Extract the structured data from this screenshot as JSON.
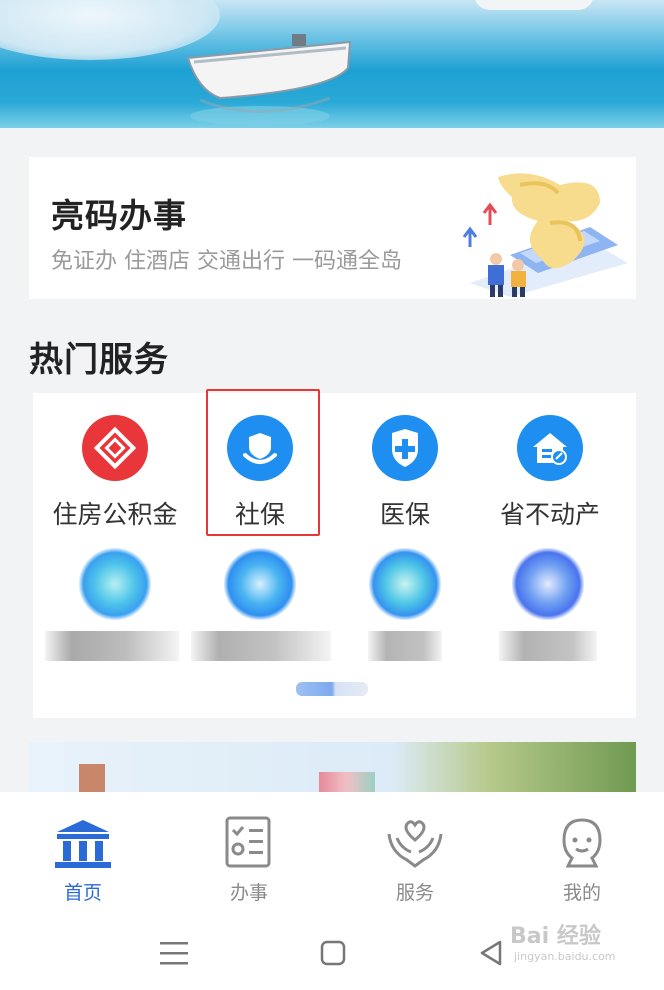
{
  "qr_card": {
    "title": "亮码办事",
    "subtitle": "免证办 住酒店 交通出行 一码通全岛"
  },
  "hot_services": {
    "title": "热门服务",
    "items": [
      {
        "label": "住房公积金",
        "icon": "housing-fund-icon",
        "color": "#e8363b"
      },
      {
        "label": "社保",
        "icon": "social-security-icon",
        "color": "#1f8ef1"
      },
      {
        "label": "医保",
        "icon": "medical-insurance-shield-icon",
        "color": "#1f8ef1"
      },
      {
        "label": "省不动产",
        "icon": "real-estate-house-icon",
        "color": "#1f8ef1"
      }
    ]
  },
  "tabbar": {
    "tabs": [
      {
        "label": "首页",
        "icon": "home-building-icon",
        "active": true
      },
      {
        "label": "办事",
        "icon": "checklist-icon",
        "active": false
      },
      {
        "label": "服务",
        "icon": "heart-hands-icon",
        "active": false
      },
      {
        "label": "我的",
        "icon": "person-icon",
        "active": false
      }
    ]
  },
  "watermark": {
    "text": "Bai 经验",
    "sub": "jingyan.baidu.com"
  },
  "colors": {
    "accent": "#2b6bd8",
    "highlight_box": "#e53935"
  }
}
